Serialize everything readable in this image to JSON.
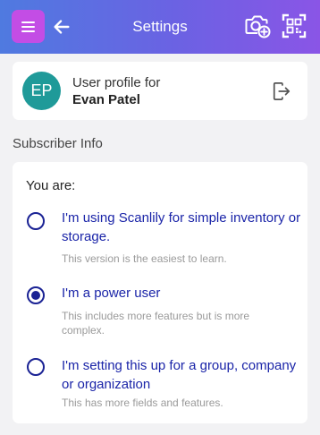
{
  "header": {
    "title": "Settings",
    "colors": {
      "gradient_start": "#4f7ae0",
      "gradient_end": "#8a55e6",
      "menu_button": "#c34de5"
    },
    "icons": [
      "menu-icon",
      "back-arrow-icon",
      "add-photo-camera-icon",
      "scan-qr-icon"
    ]
  },
  "profile": {
    "initials": "EP",
    "label": "User profile for",
    "name": "Evan Patel",
    "avatar_color": "#1f9a99",
    "action_icon": "logout-icon"
  },
  "subscriber": {
    "section_title": "Subscriber Info",
    "prompt": "You are:",
    "options": [
      {
        "label": "I'm using Scanlily for simple inventory or storage.",
        "description": "This version is the easiest to learn.",
        "selected": false
      },
      {
        "label": "I'm a power user",
        "description": "This includes more features but is more complex.",
        "selected": true
      },
      {
        "label": "I'm setting this up for a group, company or organization",
        "description": "This has more fields and features.",
        "selected": false
      }
    ],
    "accent_color": "#1a24a8"
  }
}
